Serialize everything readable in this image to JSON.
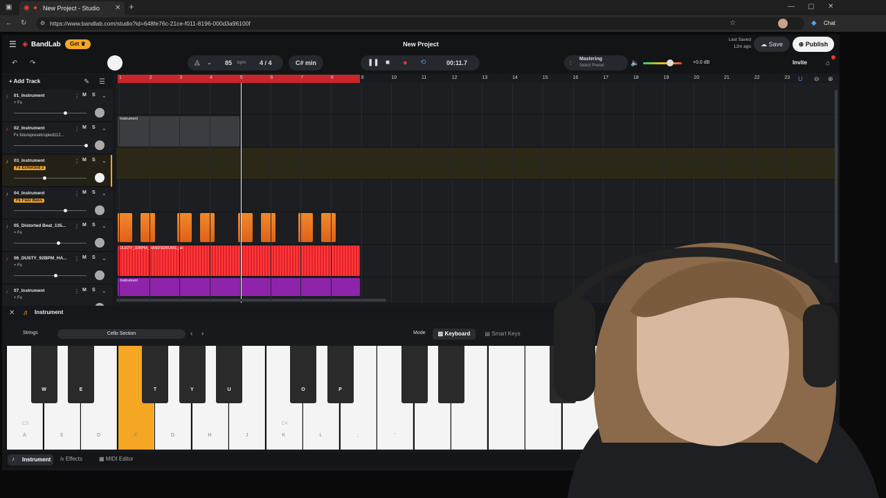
{
  "browser": {
    "tab_title": "New Project - Studio",
    "url": "https://www.bandlab.com/studio?id=648fe76c-21ce-f011-8196-000d3a96100f",
    "chat_label": "Chat"
  },
  "header": {
    "logo_text": "BandLab",
    "get_label": "Get",
    "project_title": "New Project",
    "last_saved_label": "Last Saved",
    "last_saved_time": "12m ago",
    "save_label": "Save",
    "publish_label": "Publish"
  },
  "toolbar": {
    "bpm_value": "85",
    "bpm_unit": "bpm",
    "time_signature": "4 / 4",
    "key": "C# min",
    "time_display": "00:11.7",
    "mastering_label": "Mastering",
    "mastering_sub": "Select Preset",
    "volume_db": "+0.0 dB",
    "invite_label": "Invite"
  },
  "tracks_header": {
    "add_track_label": "Add Track"
  },
  "ruler": {
    "bars": [
      "1",
      "2",
      "3",
      "4",
      "5",
      "6",
      "7",
      "8",
      "9",
      "10",
      "11",
      "12",
      "13",
      "14",
      "15",
      "16",
      "17",
      "18",
      "19",
      "20",
      "21",
      "22",
      "23"
    ]
  },
  "tracks": [
    {
      "name": "01_Instrument",
      "fx": "+ Fx",
      "fx_tag": false
    },
    {
      "name": "02_Instrument",
      "fx": "Fx futurepresetcopied112...",
      "fx_tag": false
    },
    {
      "name": "03_Instrument",
      "fx": "Fx EchoGod 2",
      "fx_tag": true
    },
    {
      "name": "04_Instrument",
      "fx": "Fx Fuzz Bass",
      "fx_tag": true
    },
    {
      "name": "05_Distorted Beat_135...",
      "fx": "+ Fx",
      "fx_tag": false
    },
    {
      "name": "06_DUSTY_92BPM_HA...",
      "fx": "+ Fx",
      "fx_tag": false
    },
    {
      "name": "07_Instrument",
      "fx": "+ Fx",
      "fx_tag": false
    }
  ],
  "clips": {
    "track2_label": "Instrument",
    "track6_label": "DUSTY_92BPM_HANDSDRUMS_ab",
    "track7_label": "Instrument"
  },
  "instrument_panel": {
    "title": "Instrument",
    "category": "Strings",
    "preset": "Cello Section",
    "mode_label": "Mode",
    "keyboard_label": "Keyboard",
    "smart_keys_label": "Smart Keys"
  },
  "keyboard": {
    "white_keys": [
      "A",
      "S",
      "D",
      "F",
      "G",
      "H",
      "J",
      "K",
      "L",
      ";",
      "'",
      "",
      "",
      "",
      "",
      ""
    ],
    "black_keys": [
      "W",
      "E",
      "T",
      "Y",
      "U",
      "O",
      "P",
      "",
      "",
      ""
    ],
    "octave_labels": [
      "C3",
      "C4"
    ]
  },
  "bottom_tabs": {
    "instrument": "Instrument",
    "effects": "Effects",
    "midi_editor": "MIDI Editor"
  },
  "colors": {
    "accent_orange": "#f5a623",
    "record_red": "#e53935",
    "ruler_red": "#c8252c",
    "bandlab_red": "#f03c3c"
  }
}
